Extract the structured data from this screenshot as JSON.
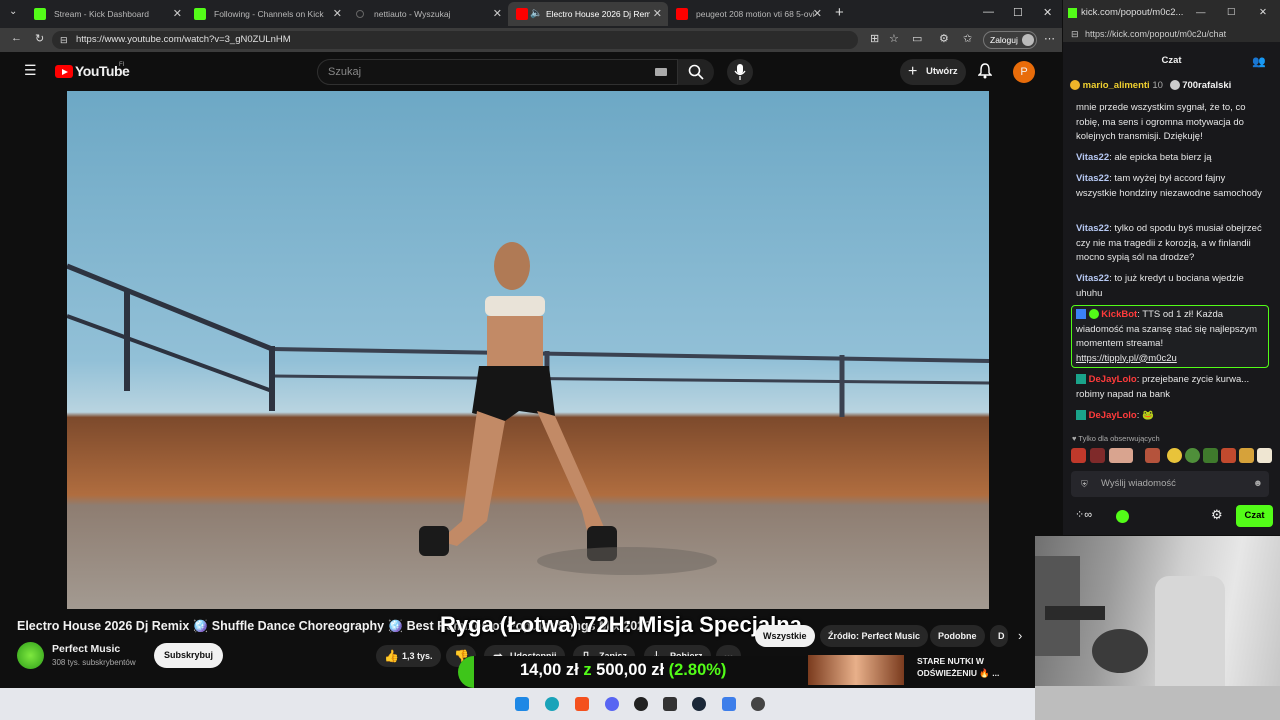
{
  "browser": {
    "tabs": [
      {
        "label": "Stream - Kick Dashboard",
        "active": false
      },
      {
        "label": "Following - Channels on Kick",
        "active": false
      },
      {
        "label": "nettiauto - Wyszukaj",
        "active": false
      },
      {
        "label": "Electro House 2026 Dj Remix",
        "active": true
      },
      {
        "label": "peugeot 208 motion vti 68 5-ovi",
        "active": false
      }
    ],
    "url": "https://www.youtube.com/watch?v=3_gN0ZULnHM",
    "login_label": "Zaloguj"
  },
  "youtube": {
    "logo": "YouTube",
    "country_code": "FI",
    "search_placeholder": "Szukaj",
    "create_label": "Utwórz",
    "avatar_letter": "P",
    "video_title": "Electro House 2026 Dj Remix 🪩 Shuffle Dance Choreography 🪩 Best Remixes of Popular Songs Mix 2026",
    "overlay_text": "Ryga (Łotwa) 72H: Misja Specjalna",
    "channel": {
      "name": "Perfect Music",
      "subs": "308 tys. subskrybentów"
    },
    "subscribe_label": "Subskrybuj",
    "likes": "1,3 tys.",
    "share_label": "Udostępnij",
    "save_label": "Zapisz",
    "download_label": "Pobierz",
    "chips": [
      "Wszystkie",
      "Źródło: Perfect Music",
      "Podobne",
      "D"
    ],
    "donation_current": "14,00 zł",
    "donation_sep": "z",
    "donation_goal": "500,00 zł",
    "donation_pct": "(2.80%)",
    "ad_line1": "STARE NUTKI W",
    "ad_line2": "ODŚWIEŻENIU 🔥 ..."
  },
  "kick": {
    "title": "kick.com/popout/m0c2...",
    "url": "https://kick.com/popout/m0c2u/chat",
    "header": "Czat",
    "pinned": [
      {
        "user": "mario_alimenti",
        "count": "10"
      },
      {
        "user": "700rafalski",
        "count": ""
      }
    ],
    "messages": [
      {
        "user": "",
        "text": "mnie przede wszystkim sygnał, że to, co robię, ma sens i ogromna motywacja do kolejnych transmisji. Dziękuję!",
        "color": "#e6e6e6"
      },
      {
        "user": "Vitas22",
        "text": "ale epicka beta bierz ją",
        "color": "#b7c9f4"
      },
      {
        "user": "Vitas22",
        "text": "tam wyżej był accord fajny wszystkie hondziny niezawodne samochody",
        "color": "#b7c9f4"
      },
      {
        "user": "Vitas22",
        "text": "tylko od spodu byś musiał obejrzeć czy nie ma tragedii z korozją, a w finlandii mocno sypią sól na drodze?",
        "color": "#b7c9f4"
      },
      {
        "user": "Vitas22",
        "text": "to już kredyt u bociana wjedzie uhuhu",
        "color": "#b7c9f4"
      },
      {
        "user": "KickBot",
        "text": "TTS od 1 zł! Każda wiadomość ma szansę stać się najlepszym momentem streama!",
        "link": "https://tipply.pl/@m0c2u",
        "color": "#ff3b3b"
      },
      {
        "user": "DeJayLolo",
        "text": "przejebane zycie kurwa... robimy napad na bank",
        "color": "#ff3b3b"
      },
      {
        "user": "DeJayLolo",
        "text": "🐸",
        "color": "#ff3b3b"
      }
    ],
    "followers_only": "Tylko dla obserwujących",
    "input_placeholder": "Wyślij wiadomość",
    "chat_button": "Czat"
  }
}
